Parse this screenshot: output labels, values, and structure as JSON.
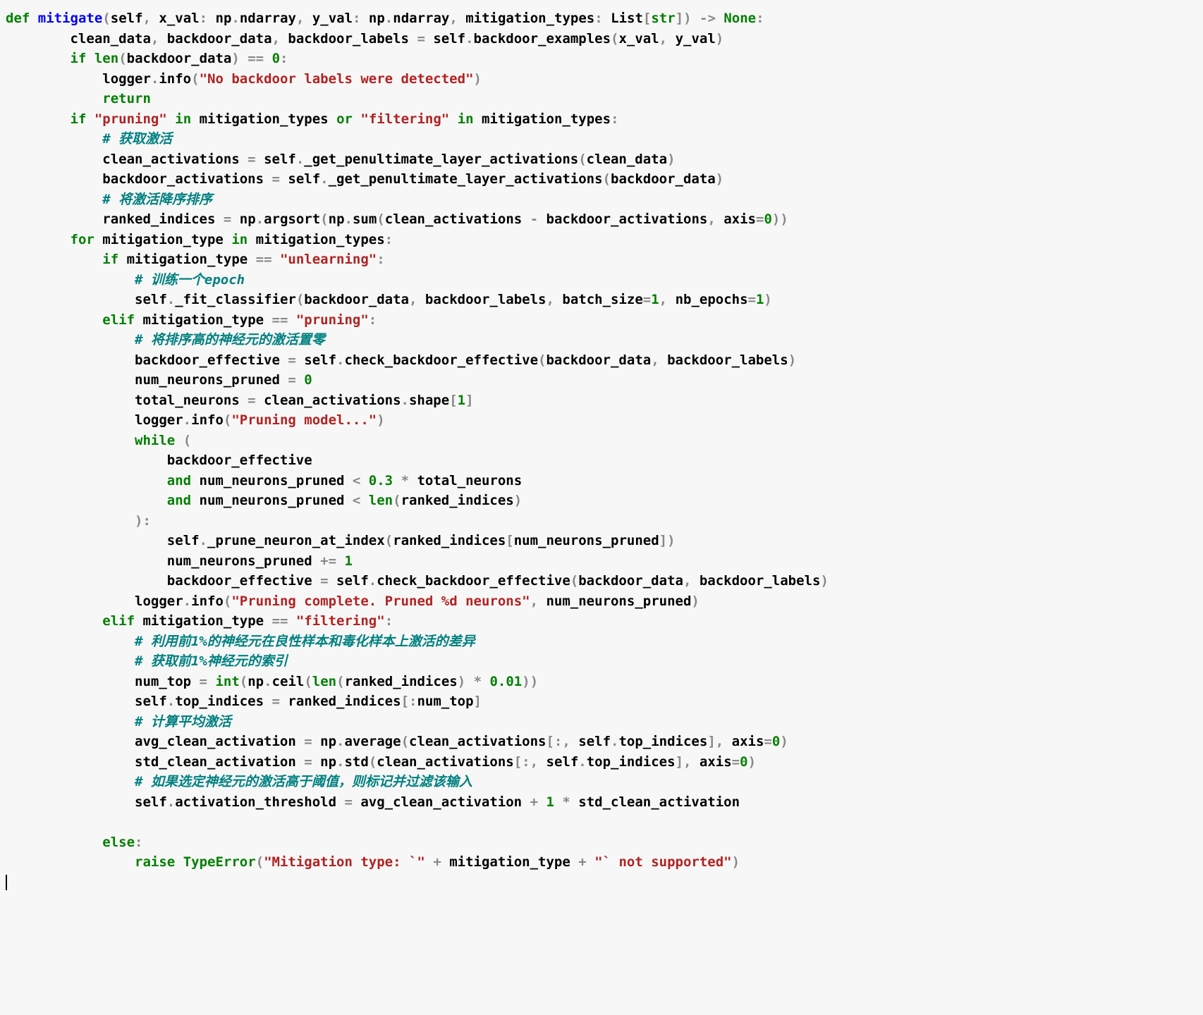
{
  "tokens": [
    {
      "c": "kw",
      "t": "def",
      "n": "keyword-def"
    },
    {
      "c": "plain",
      "t": " "
    },
    {
      "c": "fn",
      "t": "mitigate",
      "n": "function-name"
    },
    {
      "c": "op",
      "t": "("
    },
    {
      "c": "plain",
      "t": "self"
    },
    {
      "c": "op",
      "t": ", "
    },
    {
      "c": "plain",
      "t": "x_val"
    },
    {
      "c": "op",
      "t": ": "
    },
    {
      "c": "plain",
      "t": "np"
    },
    {
      "c": "op",
      "t": "."
    },
    {
      "c": "plain",
      "t": "ndarray"
    },
    {
      "c": "op",
      "t": ", "
    },
    {
      "c": "plain",
      "t": "y_val"
    },
    {
      "c": "op",
      "t": ": "
    },
    {
      "c": "plain",
      "t": "np"
    },
    {
      "c": "op",
      "t": "."
    },
    {
      "c": "plain",
      "t": "ndarray"
    },
    {
      "c": "op",
      "t": ", "
    },
    {
      "c": "plain",
      "t": "mitigation_types"
    },
    {
      "c": "op",
      "t": ": "
    },
    {
      "c": "plain",
      "t": "List"
    },
    {
      "c": "op",
      "t": "["
    },
    {
      "c": "bi",
      "t": "str"
    },
    {
      "c": "op",
      "t": "]) "
    },
    {
      "c": "op",
      "t": "-> "
    },
    {
      "c": "ty",
      "t": "None"
    },
    {
      "c": "op",
      "t": ":"
    },
    {
      "nl": true
    },
    {
      "c": "plain",
      "t": "        clean_data"
    },
    {
      "c": "op",
      "t": ", "
    },
    {
      "c": "plain",
      "t": "backdoor_data"
    },
    {
      "c": "op",
      "t": ", "
    },
    {
      "c": "plain",
      "t": "backdoor_labels "
    },
    {
      "c": "op",
      "t": "= "
    },
    {
      "c": "plain",
      "t": "self"
    },
    {
      "c": "op",
      "t": "."
    },
    {
      "c": "plain",
      "t": "backdoor_examples"
    },
    {
      "c": "op",
      "t": "("
    },
    {
      "c": "plain",
      "t": "x_val"
    },
    {
      "c": "op",
      "t": ", "
    },
    {
      "c": "plain",
      "t": "y_val"
    },
    {
      "c": "op",
      "t": ")"
    },
    {
      "nl": true
    },
    {
      "c": "plain",
      "t": "        "
    },
    {
      "c": "kw",
      "t": "if"
    },
    {
      "c": "plain",
      "t": " "
    },
    {
      "c": "bi",
      "t": "len"
    },
    {
      "c": "op",
      "t": "("
    },
    {
      "c": "plain",
      "t": "backdoor_data"
    },
    {
      "c": "op",
      "t": ") == "
    },
    {
      "c": "num",
      "t": "0"
    },
    {
      "c": "op",
      "t": ":"
    },
    {
      "nl": true
    },
    {
      "c": "plain",
      "t": "            logger"
    },
    {
      "c": "op",
      "t": "."
    },
    {
      "c": "plain",
      "t": "info"
    },
    {
      "c": "op",
      "t": "("
    },
    {
      "c": "str",
      "t": "\"No backdoor labels were detected\""
    },
    {
      "c": "op",
      "t": ")"
    },
    {
      "nl": true
    },
    {
      "c": "plain",
      "t": "            "
    },
    {
      "c": "kw",
      "t": "return"
    },
    {
      "nl": true
    },
    {
      "c": "plain",
      "t": "        "
    },
    {
      "c": "kw",
      "t": "if"
    },
    {
      "c": "plain",
      "t": " "
    },
    {
      "c": "str",
      "t": "\"pruning\""
    },
    {
      "c": "plain",
      "t": " "
    },
    {
      "c": "kw",
      "t": "in"
    },
    {
      "c": "plain",
      "t": " mitigation_types "
    },
    {
      "c": "kw",
      "t": "or"
    },
    {
      "c": "plain",
      "t": " "
    },
    {
      "c": "str",
      "t": "\"filtering\""
    },
    {
      "c": "plain",
      "t": " "
    },
    {
      "c": "kw",
      "t": "in"
    },
    {
      "c": "plain",
      "t": " mitigation_types"
    },
    {
      "c": "op",
      "t": ":"
    },
    {
      "nl": true
    },
    {
      "c": "plain",
      "t": "            "
    },
    {
      "c": "cm",
      "t": "# 获取激活",
      "n": "comment"
    },
    {
      "nl": true
    },
    {
      "c": "plain",
      "t": "            clean_activations "
    },
    {
      "c": "op",
      "t": "= "
    },
    {
      "c": "plain",
      "t": "self"
    },
    {
      "c": "op",
      "t": "."
    },
    {
      "c": "plain",
      "t": "_get_penultimate_layer_activations"
    },
    {
      "c": "op",
      "t": "("
    },
    {
      "c": "plain",
      "t": "clean_data"
    },
    {
      "c": "op",
      "t": ")"
    },
    {
      "nl": true
    },
    {
      "c": "plain",
      "t": "            backdoor_activations "
    },
    {
      "c": "op",
      "t": "= "
    },
    {
      "c": "plain",
      "t": "self"
    },
    {
      "c": "op",
      "t": "."
    },
    {
      "c": "plain",
      "t": "_get_penultimate_layer_activations"
    },
    {
      "c": "op",
      "t": "("
    },
    {
      "c": "plain",
      "t": "backdoor_data"
    },
    {
      "c": "op",
      "t": ")"
    },
    {
      "nl": true
    },
    {
      "c": "plain",
      "t": "            "
    },
    {
      "c": "cm",
      "t": "# 将激活降序排序",
      "n": "comment"
    },
    {
      "nl": true
    },
    {
      "c": "plain",
      "t": "            ranked_indices "
    },
    {
      "c": "op",
      "t": "= "
    },
    {
      "c": "plain",
      "t": "np"
    },
    {
      "c": "op",
      "t": "."
    },
    {
      "c": "plain",
      "t": "argsort"
    },
    {
      "c": "op",
      "t": "("
    },
    {
      "c": "plain",
      "t": "np"
    },
    {
      "c": "op",
      "t": "."
    },
    {
      "c": "plain",
      "t": "sum"
    },
    {
      "c": "op",
      "t": "("
    },
    {
      "c": "plain",
      "t": "clean_activations "
    },
    {
      "c": "op",
      "t": "- "
    },
    {
      "c": "plain",
      "t": "backdoor_activations"
    },
    {
      "c": "op",
      "t": ", "
    },
    {
      "c": "plain",
      "t": "axis"
    },
    {
      "c": "op",
      "t": "="
    },
    {
      "c": "num",
      "t": "0"
    },
    {
      "c": "op",
      "t": "))"
    },
    {
      "nl": true
    },
    {
      "c": "plain",
      "t": "        "
    },
    {
      "c": "kw",
      "t": "for"
    },
    {
      "c": "plain",
      "t": " mitigation_type "
    },
    {
      "c": "kw",
      "t": "in"
    },
    {
      "c": "plain",
      "t": " mitigation_types"
    },
    {
      "c": "op",
      "t": ":"
    },
    {
      "nl": true
    },
    {
      "c": "plain",
      "t": "            "
    },
    {
      "c": "kw",
      "t": "if"
    },
    {
      "c": "plain",
      "t": " mitigation_type "
    },
    {
      "c": "op",
      "t": "== "
    },
    {
      "c": "str",
      "t": "\"unlearning\""
    },
    {
      "c": "op",
      "t": ":"
    },
    {
      "nl": true
    },
    {
      "c": "plain",
      "t": "                "
    },
    {
      "c": "cm",
      "t": "# 训练一个epoch",
      "n": "comment"
    },
    {
      "nl": true
    },
    {
      "c": "plain",
      "t": "                self"
    },
    {
      "c": "op",
      "t": "."
    },
    {
      "c": "plain",
      "t": "_fit_classifier"
    },
    {
      "c": "op",
      "t": "("
    },
    {
      "c": "plain",
      "t": "backdoor_data"
    },
    {
      "c": "op",
      "t": ", "
    },
    {
      "c": "plain",
      "t": "backdoor_labels"
    },
    {
      "c": "op",
      "t": ", "
    },
    {
      "c": "plain",
      "t": "batch_size"
    },
    {
      "c": "op",
      "t": "="
    },
    {
      "c": "num",
      "t": "1"
    },
    {
      "c": "op",
      "t": ", "
    },
    {
      "c": "plain",
      "t": "nb_epochs"
    },
    {
      "c": "op",
      "t": "="
    },
    {
      "c": "num",
      "t": "1"
    },
    {
      "c": "op",
      "t": ")"
    },
    {
      "nl": true
    },
    {
      "c": "plain",
      "t": "            "
    },
    {
      "c": "kw",
      "t": "elif"
    },
    {
      "c": "plain",
      "t": " mitigation_type "
    },
    {
      "c": "op",
      "t": "== "
    },
    {
      "c": "str",
      "t": "\"pruning\""
    },
    {
      "c": "op",
      "t": ":"
    },
    {
      "nl": true
    },
    {
      "c": "plain",
      "t": "                "
    },
    {
      "c": "cm",
      "t": "# 将排序高的神经元的激活置零",
      "n": "comment"
    },
    {
      "nl": true
    },
    {
      "c": "plain",
      "t": "                backdoor_effective "
    },
    {
      "c": "op",
      "t": "= "
    },
    {
      "c": "plain",
      "t": "self"
    },
    {
      "c": "op",
      "t": "."
    },
    {
      "c": "plain",
      "t": "check_backdoor_effective"
    },
    {
      "c": "op",
      "t": "("
    },
    {
      "c": "plain",
      "t": "backdoor_data"
    },
    {
      "c": "op",
      "t": ", "
    },
    {
      "c": "plain",
      "t": "backdoor_labels"
    },
    {
      "c": "op",
      "t": ")"
    },
    {
      "nl": true
    },
    {
      "c": "plain",
      "t": "                num_neurons_pruned "
    },
    {
      "c": "op",
      "t": "= "
    },
    {
      "c": "num",
      "t": "0"
    },
    {
      "nl": true
    },
    {
      "c": "plain",
      "t": "                total_neurons "
    },
    {
      "c": "op",
      "t": "= "
    },
    {
      "c": "plain",
      "t": "clean_activations"
    },
    {
      "c": "op",
      "t": "."
    },
    {
      "c": "plain",
      "t": "shape"
    },
    {
      "c": "op",
      "t": "["
    },
    {
      "c": "num",
      "t": "1"
    },
    {
      "c": "op",
      "t": "]"
    },
    {
      "nl": true
    },
    {
      "c": "plain",
      "t": "                logger"
    },
    {
      "c": "op",
      "t": "."
    },
    {
      "c": "plain",
      "t": "info"
    },
    {
      "c": "op",
      "t": "("
    },
    {
      "c": "str",
      "t": "\"Pruning model...\""
    },
    {
      "c": "op",
      "t": ")"
    },
    {
      "nl": true
    },
    {
      "c": "plain",
      "t": "                "
    },
    {
      "c": "kw",
      "t": "while"
    },
    {
      "c": "plain",
      "t": " "
    },
    {
      "c": "op",
      "t": "("
    },
    {
      "nl": true
    },
    {
      "c": "plain",
      "t": "                    backdoor_effective"
    },
    {
      "nl": true
    },
    {
      "c": "plain",
      "t": "                    "
    },
    {
      "c": "kw",
      "t": "and"
    },
    {
      "c": "plain",
      "t": " num_neurons_pruned "
    },
    {
      "c": "op",
      "t": "< "
    },
    {
      "c": "num",
      "t": "0.3"
    },
    {
      "c": "plain",
      "t": " "
    },
    {
      "c": "op",
      "t": "* "
    },
    {
      "c": "plain",
      "t": "total_neurons"
    },
    {
      "nl": true
    },
    {
      "c": "plain",
      "t": "                    "
    },
    {
      "c": "kw",
      "t": "and"
    },
    {
      "c": "plain",
      "t": " num_neurons_pruned "
    },
    {
      "c": "op",
      "t": "< "
    },
    {
      "c": "bi",
      "t": "len"
    },
    {
      "c": "op",
      "t": "("
    },
    {
      "c": "plain",
      "t": "ranked_indices"
    },
    {
      "c": "op",
      "t": ")"
    },
    {
      "nl": true
    },
    {
      "c": "plain",
      "t": "                "
    },
    {
      "c": "op",
      "t": "):"
    },
    {
      "nl": true
    },
    {
      "c": "plain",
      "t": "                    self"
    },
    {
      "c": "op",
      "t": "."
    },
    {
      "c": "plain",
      "t": "_prune_neuron_at_index"
    },
    {
      "c": "op",
      "t": "("
    },
    {
      "c": "plain",
      "t": "ranked_indices"
    },
    {
      "c": "op",
      "t": "["
    },
    {
      "c": "plain",
      "t": "num_neurons_pruned"
    },
    {
      "c": "op",
      "t": "])"
    },
    {
      "nl": true
    },
    {
      "c": "plain",
      "t": "                    num_neurons_pruned "
    },
    {
      "c": "op",
      "t": "+= "
    },
    {
      "c": "num",
      "t": "1"
    },
    {
      "nl": true
    },
    {
      "c": "plain",
      "t": "                    backdoor_effective "
    },
    {
      "c": "op",
      "t": "= "
    },
    {
      "c": "plain",
      "t": "self"
    },
    {
      "c": "op",
      "t": "."
    },
    {
      "c": "plain",
      "t": "check_backdoor_effective"
    },
    {
      "c": "op",
      "t": "("
    },
    {
      "c": "plain",
      "t": "backdoor_data"
    },
    {
      "c": "op",
      "t": ", "
    },
    {
      "c": "plain",
      "t": "backdoor_labels"
    },
    {
      "c": "op",
      "t": ")"
    },
    {
      "nl": true
    },
    {
      "c": "plain",
      "t": "                logger"
    },
    {
      "c": "op",
      "t": "."
    },
    {
      "c": "plain",
      "t": "info"
    },
    {
      "c": "op",
      "t": "("
    },
    {
      "c": "str",
      "t": "\"Pruning complete. Pruned %d neurons\""
    },
    {
      "c": "op",
      "t": ", "
    },
    {
      "c": "plain",
      "t": "num_neurons_pruned"
    },
    {
      "c": "op",
      "t": ")"
    },
    {
      "nl": true
    },
    {
      "c": "plain",
      "t": "            "
    },
    {
      "c": "kw",
      "t": "elif"
    },
    {
      "c": "plain",
      "t": " mitigation_type "
    },
    {
      "c": "op",
      "t": "== "
    },
    {
      "c": "str",
      "t": "\"filtering\""
    },
    {
      "c": "op",
      "t": ":"
    },
    {
      "nl": true
    },
    {
      "c": "plain",
      "t": "                "
    },
    {
      "c": "cm",
      "t": "# 利用前1%的神经元在良性样本和毒化样本上激活的差异",
      "n": "comment"
    },
    {
      "nl": true
    },
    {
      "c": "plain",
      "t": "                "
    },
    {
      "c": "cm",
      "t": "# 获取前1%神经元的索引",
      "n": "comment"
    },
    {
      "nl": true
    },
    {
      "c": "plain",
      "t": "                num_top "
    },
    {
      "c": "op",
      "t": "= "
    },
    {
      "c": "bi",
      "t": "int"
    },
    {
      "c": "op",
      "t": "("
    },
    {
      "c": "plain",
      "t": "np"
    },
    {
      "c": "op",
      "t": "."
    },
    {
      "c": "plain",
      "t": "ceil"
    },
    {
      "c": "op",
      "t": "("
    },
    {
      "c": "bi",
      "t": "len"
    },
    {
      "c": "op",
      "t": "("
    },
    {
      "c": "plain",
      "t": "ranked_indices"
    },
    {
      "c": "op",
      "t": ") * "
    },
    {
      "c": "num",
      "t": "0.01"
    },
    {
      "c": "op",
      "t": "))"
    },
    {
      "nl": true
    },
    {
      "c": "plain",
      "t": "                self"
    },
    {
      "c": "op",
      "t": "."
    },
    {
      "c": "plain",
      "t": "top_indices "
    },
    {
      "c": "op",
      "t": "= "
    },
    {
      "c": "plain",
      "t": "ranked_indices"
    },
    {
      "c": "op",
      "t": "[:"
    },
    {
      "c": "plain",
      "t": "num_top"
    },
    {
      "c": "op",
      "t": "]"
    },
    {
      "nl": true
    },
    {
      "c": "plain",
      "t": "                "
    },
    {
      "c": "cm",
      "t": "# 计算平均激活",
      "n": "comment"
    },
    {
      "nl": true
    },
    {
      "c": "plain",
      "t": "                avg_clean_activation "
    },
    {
      "c": "op",
      "t": "= "
    },
    {
      "c": "plain",
      "t": "np"
    },
    {
      "c": "op",
      "t": "."
    },
    {
      "c": "plain",
      "t": "average"
    },
    {
      "c": "op",
      "t": "("
    },
    {
      "c": "plain",
      "t": "clean_activations"
    },
    {
      "c": "op",
      "t": "[:, "
    },
    {
      "c": "plain",
      "t": "self"
    },
    {
      "c": "op",
      "t": "."
    },
    {
      "c": "plain",
      "t": "top_indices"
    },
    {
      "c": "op",
      "t": "], "
    },
    {
      "c": "plain",
      "t": "axis"
    },
    {
      "c": "op",
      "t": "="
    },
    {
      "c": "num",
      "t": "0"
    },
    {
      "c": "op",
      "t": ")"
    },
    {
      "nl": true
    },
    {
      "c": "plain",
      "t": "                std_clean_activation "
    },
    {
      "c": "op",
      "t": "= "
    },
    {
      "c": "plain",
      "t": "np"
    },
    {
      "c": "op",
      "t": "."
    },
    {
      "c": "plain",
      "t": "std"
    },
    {
      "c": "op",
      "t": "("
    },
    {
      "c": "plain",
      "t": "clean_activations"
    },
    {
      "c": "op",
      "t": "[:, "
    },
    {
      "c": "plain",
      "t": "self"
    },
    {
      "c": "op",
      "t": "."
    },
    {
      "c": "plain",
      "t": "top_indices"
    },
    {
      "c": "op",
      "t": "], "
    },
    {
      "c": "plain",
      "t": "axis"
    },
    {
      "c": "op",
      "t": "="
    },
    {
      "c": "num",
      "t": "0"
    },
    {
      "c": "op",
      "t": ")"
    },
    {
      "nl": true
    },
    {
      "c": "plain",
      "t": "                "
    },
    {
      "c": "cm",
      "t": "# 如果选定神经元的激活高于阈值，则标记并过滤该输入",
      "n": "comment"
    },
    {
      "nl": true
    },
    {
      "c": "plain",
      "t": "                self"
    },
    {
      "c": "op",
      "t": "."
    },
    {
      "c": "plain",
      "t": "activation_threshold "
    },
    {
      "c": "op",
      "t": "= "
    },
    {
      "c": "plain",
      "t": "avg_clean_activation "
    },
    {
      "c": "op",
      "t": "+ "
    },
    {
      "c": "num",
      "t": "1"
    },
    {
      "c": "plain",
      "t": " "
    },
    {
      "c": "op",
      "t": "* "
    },
    {
      "c": "plain",
      "t": "std_clean_activation"
    },
    {
      "nl": true
    },
    {
      "nl": true
    },
    {
      "c": "plain",
      "t": "            "
    },
    {
      "c": "kw",
      "t": "else"
    },
    {
      "c": "op",
      "t": ":"
    },
    {
      "nl": true
    },
    {
      "c": "plain",
      "t": "                "
    },
    {
      "c": "kw",
      "t": "raise"
    },
    {
      "c": "plain",
      "t": " "
    },
    {
      "c": "ty",
      "t": "TypeError"
    },
    {
      "c": "op",
      "t": "("
    },
    {
      "c": "str",
      "t": "\"Mitigation type: `\""
    },
    {
      "c": "plain",
      "t": " "
    },
    {
      "c": "op",
      "t": "+ "
    },
    {
      "c": "plain",
      "t": "mitigation_type "
    },
    {
      "c": "op",
      "t": "+ "
    },
    {
      "c": "str",
      "t": "\"` not supported\""
    },
    {
      "c": "op",
      "t": ")"
    },
    {
      "nl": true
    }
  ]
}
